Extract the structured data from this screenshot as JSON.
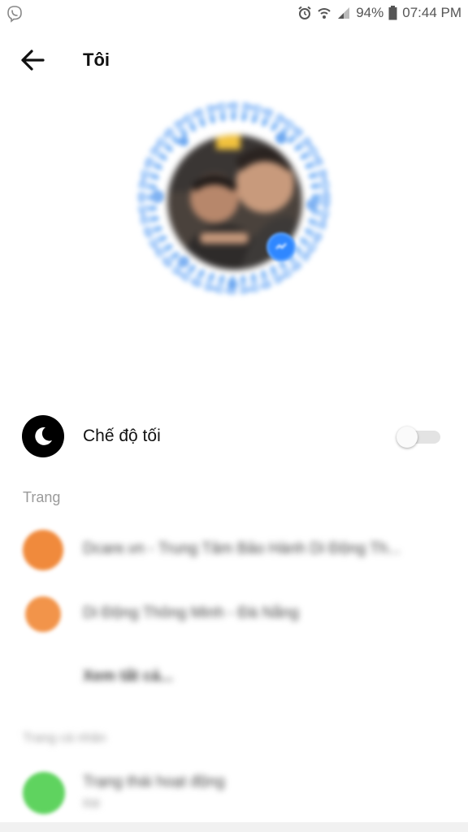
{
  "status_bar": {
    "app_icon": "viber-icon",
    "battery": "94%",
    "time": "07:44 PM"
  },
  "header": {
    "title": "Tôi",
    "back_icon": "arrow-left-icon"
  },
  "dark_mode": {
    "label": "Chế độ tối",
    "icon": "moon-icon",
    "enabled": false
  },
  "pages_section": {
    "label": "Trang",
    "items": [
      {
        "name": "Dcare.vn - Trung Tâm Bảo Hành Di Động Th...",
        "icon_color": "#f08a3c"
      },
      {
        "name": "Di Động Thông Minh - Đà Nẵng",
        "icon_color": "#f2944a"
      }
    ],
    "see_all": "Xem tất cả..."
  },
  "profile_section": {
    "label": "Trang cá nhân",
    "active_status": {
      "title": "Trạng thái hoạt động",
      "subtitle": "Bật",
      "icon_color": "#5fd35f"
    }
  },
  "colors": {
    "accent": "#2f87ff",
    "section_label": "#9a9a9a"
  }
}
